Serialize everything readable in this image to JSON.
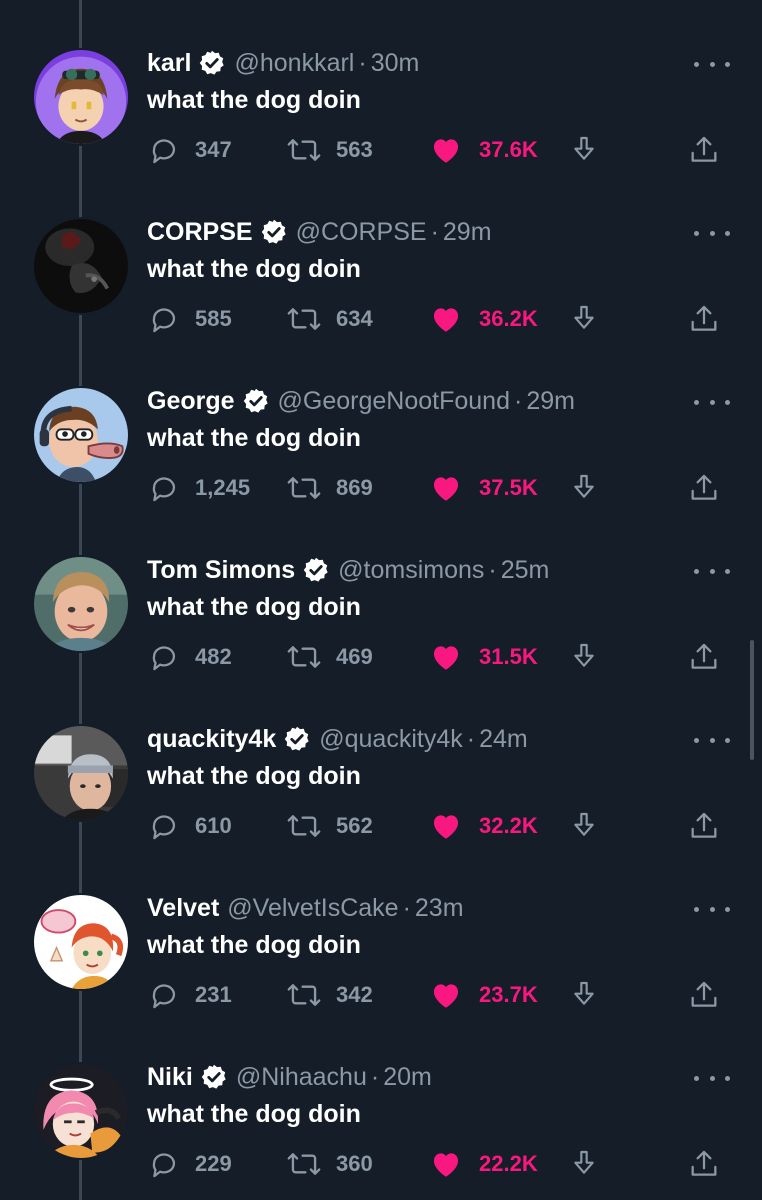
{
  "tweets": [
    {
      "name": "karl",
      "verified": true,
      "handle": "@honkkarl",
      "time": "30m",
      "text": "what the dog doin",
      "replies": "347",
      "retweets": "563",
      "likes": "37.6K"
    },
    {
      "name": "CORPSE",
      "verified": true,
      "handle": "@CORPSE",
      "time": "29m",
      "text": "what the dog doin",
      "replies": "585",
      "retweets": "634",
      "likes": "36.2K"
    },
    {
      "name": "George",
      "verified": true,
      "handle": "@GeorgeNootFound",
      "time": "29m",
      "text": "what the dog doin",
      "replies": "1,245",
      "retweets": "869",
      "likes": "37.5K"
    },
    {
      "name": "Tom Simons",
      "verified": true,
      "handle": "@tomsimons",
      "time": "25m",
      "text": "what the dog doin",
      "replies": "482",
      "retweets": "469",
      "likes": "31.5K"
    },
    {
      "name": "quackity4k",
      "verified": true,
      "handle": "@quackity4k",
      "time": "24m",
      "text": "what the dog doin",
      "replies": "610",
      "retweets": "562",
      "likes": "32.2K"
    },
    {
      "name": "Velvet",
      "verified": false,
      "handle": "@VelvetIsCake",
      "time": "23m",
      "text": "what the dog doin",
      "replies": "231",
      "retweets": "342",
      "likes": "23.7K"
    },
    {
      "name": "Niki",
      "verified": true,
      "handle": "@Nihaachu",
      "time": "20m",
      "text": "what the dog doin",
      "replies": "229",
      "retweets": "360",
      "likes": "22.2K"
    }
  ],
  "colors": {
    "background": "#151d28",
    "secondary_text": "#8b98a5",
    "like_pink": "#f91880",
    "thread_line": "#3c4754"
  },
  "icons": [
    "reply-icon",
    "retweet-icon",
    "like-icon",
    "download-icon",
    "share-icon",
    "verified-badge-icon",
    "more-options-icon"
  ],
  "separator": "·"
}
